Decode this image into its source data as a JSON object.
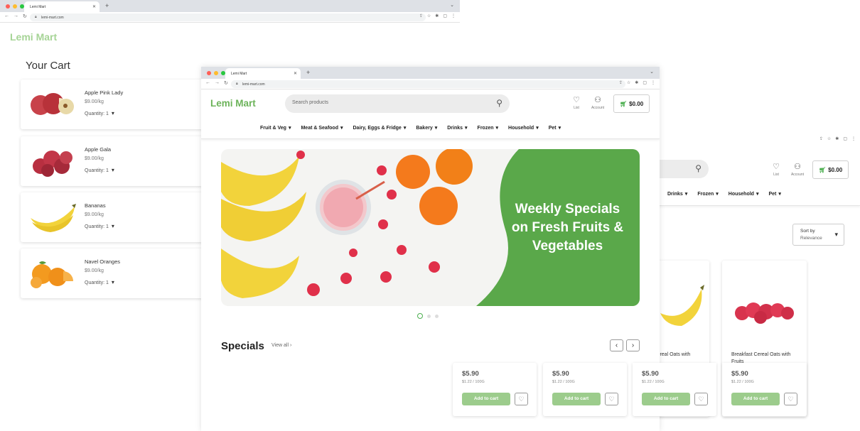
{
  "browser": {
    "tab_title": "Lemi Mart",
    "url": "lemi-mart.com"
  },
  "cart_window": {
    "logo": "Lemi Mart",
    "title": "Your Cart",
    "items": [
      {
        "name": "Apple Pink Lady",
        "price": "$9.00/kg",
        "qty_label": "Quantity:",
        "qty": "1"
      },
      {
        "name": "Apple Gala",
        "price": "$9.00/kg",
        "qty_label": "Quantity:",
        "qty": "1"
      },
      {
        "name": "Bananas",
        "price": "$9.00/kg",
        "qty_label": "Quantity:",
        "qty": "1"
      },
      {
        "name": "Navel Oranges",
        "price": "$9.00/kg",
        "qty_label": "Quantity:",
        "qty": "1"
      }
    ]
  },
  "store": {
    "logo": "Lemi Mart",
    "search_placeholder": "Search products",
    "list_label": "List",
    "account_label": "Account",
    "cart_total": "$0.00",
    "categories": [
      "Fruit & Veg",
      "Meat & Seafood",
      "Dairy, Eggs & Fridge",
      "Bakery",
      "Drinks",
      "Frozen",
      "Household",
      "Pet"
    ],
    "hero_text": "Weekly Specials on Fresh Fruits & Vegetables",
    "specials_title": "Specials",
    "view_all": "View all"
  },
  "product_cards": [
    {
      "price": "$5.90",
      "unit": "$1.22 / 100G",
      "add": "Add to cart"
    },
    {
      "price": "$5.90",
      "unit": "$1.22 / 100G",
      "add": "Add to cart"
    },
    {
      "price": "$5.90",
      "unit": "$1.22 / 100G",
      "add": "Add to cart"
    },
    {
      "price": "$5.90",
      "unit": "$1.22 / 100G",
      "add": "Add to cart"
    }
  ],
  "right_window": {
    "cart_total": "$0.00",
    "list_label": "List",
    "account_label": "Account",
    "categories": [
      "Drinks",
      "Frozen",
      "Household",
      "Pet"
    ],
    "sort_label": "Sort by",
    "sort_value": "Relevance",
    "product_names": [
      "Breakfast Cereal Oats with",
      "Breakfast Cereal Oats with Fruits"
    ]
  },
  "colors": {
    "brand_green": "#6cb35a",
    "hero_green": "#5aa84a",
    "button_green": "#9ccc8c"
  }
}
